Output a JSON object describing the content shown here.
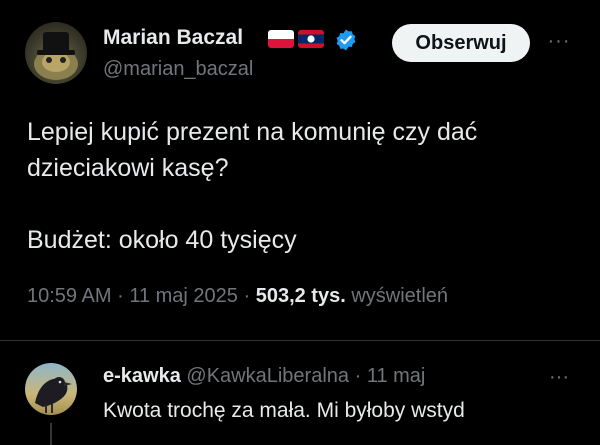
{
  "tweet": {
    "author_name": "Marian Baczal",
    "author_handle": "@marian_baczal",
    "follow_label": "Obserwuj",
    "more_label": "···",
    "text_line1": "Lepiej kupić prezent na komunię czy dać",
    "text_line2": "dzieciakowi kasę?",
    "text_line3": "Budżet: około 40 tysięcy",
    "time": "10:59 AM",
    "date": "11 maj 2025",
    "views_count": "503,2 tys.",
    "views_label": "wyświetleń",
    "separator": "·"
  },
  "reply": {
    "author_name": "e-kawka",
    "author_handle": "@KawkaLiberalna",
    "separator": "·",
    "date": "11 maj",
    "more_label": "···",
    "text": "Kwota trochę za mała. Mi byłoby wstyd"
  },
  "icons": {
    "verified": "verified-badge-icon",
    "flag1": "poland-flag-icon",
    "flag2": "laos-flag-icon",
    "more": "more-options-icon"
  },
  "colors": {
    "background": "#000000",
    "text_primary": "#e7e9ea",
    "text_secondary": "#71767b",
    "verified_blue": "#1d9bf0",
    "follow_bg": "#eff3f4",
    "divider": "#2f3336"
  }
}
